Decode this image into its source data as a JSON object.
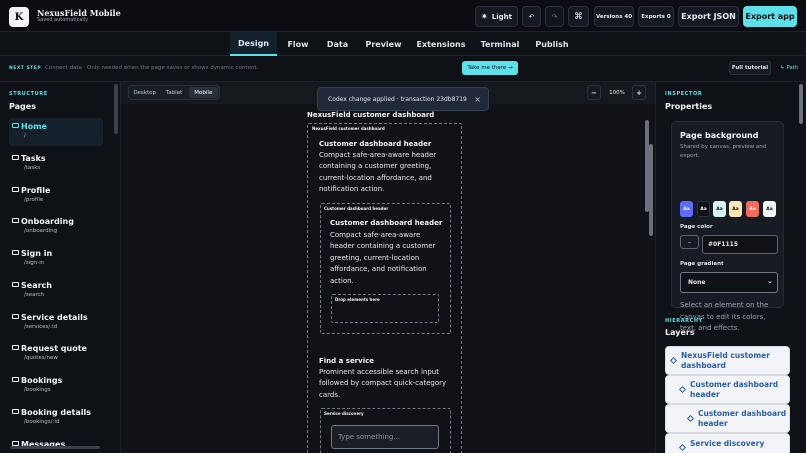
{
  "header": {
    "logo_letter": "K",
    "app_name": "NexusField Mobile",
    "save_status": "Saved automatically",
    "theme_label": "Light",
    "versions_label": "Versions 40",
    "exports_label": "Exports 0",
    "export_json_label": "Export JSON",
    "export_app_label": "Export app"
  },
  "tabs": [
    "Design",
    "Flow",
    "Data",
    "Preview",
    "Extensions",
    "Terminal",
    "Publish"
  ],
  "active_tab": "Design",
  "next_step": {
    "label": "NEXT STEP",
    "title": "Connect data",
    "description": "Only needed when the page saves or shows dynamic content.",
    "cta": "Take me there →",
    "full_tutorial": "Full tutorial",
    "path_link": "↳ Path"
  },
  "structure": {
    "section_label": "STRUCTURE",
    "heading": "Pages",
    "pages": [
      {
        "title": "Home",
        "path": "/"
      },
      {
        "title": "Tasks",
        "path": "/tasks"
      },
      {
        "title": "Profile",
        "path": "/profile"
      },
      {
        "title": "Onboarding",
        "path": "/onboarding"
      },
      {
        "title": "Sign in",
        "path": "/sign-in"
      },
      {
        "title": "Search",
        "path": "/search"
      },
      {
        "title": "Service details",
        "path": "/services/:id"
      },
      {
        "title": "Request quote",
        "path": "/quotes/new"
      },
      {
        "title": "Bookings",
        "path": "/bookings"
      },
      {
        "title": "Booking details",
        "path": "/bookings/:id"
      },
      {
        "title": "Messages",
        "path": ""
      }
    ],
    "active_page": "Home"
  },
  "canvas": {
    "devices": [
      "Desktop",
      "Tablet",
      "Mobile"
    ],
    "active_device": "Mobile",
    "zoom_minus": "−",
    "zoom_level": "100%",
    "zoom_plus": "+",
    "toast": "Codex change applied · transaction 23db8719",
    "toast_close": "×",
    "page_title": "NexusField customer dashboard",
    "root_tag": "NexusField customer dashboard",
    "section1": {
      "heading": "Customer dashboard header",
      "body_lines": [
        "Compact safe-area-aware header",
        "containing a customer greeting,",
        "current-location affordance, and",
        "notification action."
      ],
      "inner_tag": "Customer dashboard header",
      "inner_heading": "Customer dashboard header",
      "inner_body_lines": [
        "Compact safe-area-aware",
        "header containing a customer",
        "greeting, current-location",
        "affordance, and notification",
        "action."
      ],
      "drop_label": "Drop elements here"
    },
    "section2": {
      "heading": "Find a service",
      "body_lines": [
        "Prominent accessible search input",
        "followed by compact quick-category",
        "cards."
      ],
      "inner_tag": "Service discovery",
      "search_placeholder": "Type something..."
    }
  },
  "inspector": {
    "section_label": "INSPECTOR",
    "heading": "Properties",
    "card_title": "Page background",
    "card_description": "Shared by canvas, preview and export.",
    "swatch_text": "Aa",
    "swatches": [
      "#5b6cff",
      "#0f1115",
      "#d7f5ef",
      "#fbe7b5",
      "#f26b5b",
      "#f2f4f7"
    ],
    "swatch_text_colors": [
      "#ffffff",
      "#ffffff",
      "#0f1115",
      "#0f1115",
      "#ffffff",
      "#0f1115"
    ],
    "color_label": "Page color",
    "color_button": "–",
    "color_value": "#0F1115",
    "gradient_label": "Page gradient",
    "gradient_value": "None",
    "hint": "Select an element on the canvas to edit its colors, text, and effects."
  },
  "hierarchy": {
    "section_label": "HIERARCHY",
    "heading": "Layers",
    "layers": [
      {
        "title_lines": [
          "NexusField customer",
          "dashboard"
        ],
        "depth": 0
      },
      {
        "title_lines": [
          "Customer dashboard",
          "header"
        ],
        "depth": 1
      },
      {
        "title_lines": [
          "Customer dashboard",
          "header"
        ],
        "depth": 2
      },
      {
        "title_lines": [
          "Service discovery"
        ],
        "depth": 1
      }
    ]
  }
}
